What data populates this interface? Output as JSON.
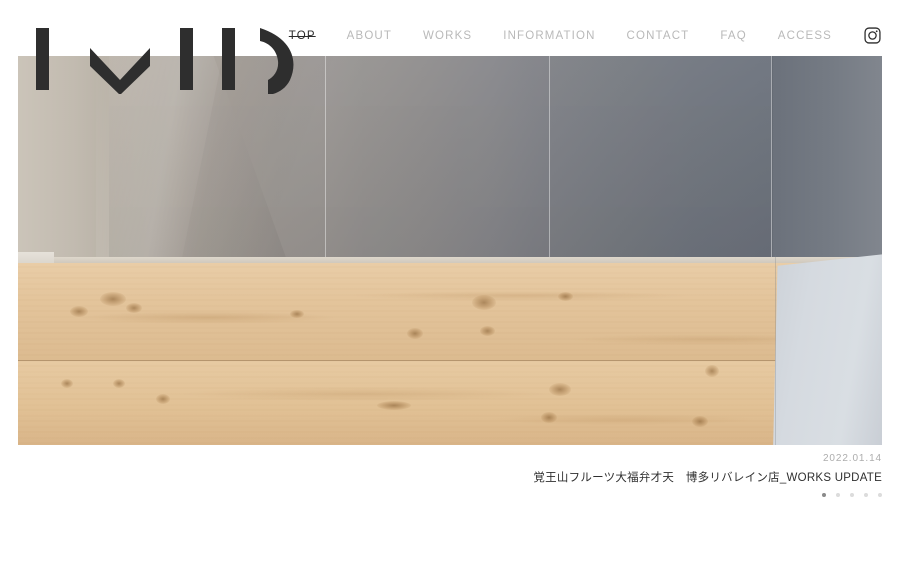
{
  "site": {
    "logo_text": "IMID",
    "logo_name": "imid-logo"
  },
  "nav": {
    "items": [
      {
        "label": "TOP",
        "name": "nav-item-top",
        "active": true
      },
      {
        "label": "ABOUT",
        "name": "nav-item-about",
        "active": false
      },
      {
        "label": "WORKS",
        "name": "nav-item-works",
        "active": false
      },
      {
        "label": "INFORMATION",
        "name": "nav-item-information",
        "active": false
      },
      {
        "label": "CONTACT",
        "name": "nav-item-contact",
        "active": false
      },
      {
        "label": "FAQ",
        "name": "nav-item-faq",
        "active": false
      },
      {
        "label": "ACCESS",
        "name": "nav-item-access",
        "active": false
      }
    ],
    "social": {
      "icon": "instagram-icon",
      "label": "Instagram"
    }
  },
  "hero": {
    "alt": "interior photo of grey and beige wall panels above a light wood floor",
    "slide_caption": {
      "date": "2022.01.14",
      "title": "覚王山フルーツ大福弁才天　博多リバレイン店_WORKS UPDATE"
    },
    "pagination": {
      "total": 5,
      "active_index": 0
    }
  },
  "colors": {
    "nav_inactive": "#b9b9b9",
    "nav_active": "#2b2b2b",
    "caption_date": "#adadad",
    "caption_title": "#2f2f2f",
    "dot_active": "#8a8a8a",
    "dot_inactive": "#dcdcdc",
    "logo_mark": "#2e2e2e",
    "page_background": "#ffffff"
  }
}
